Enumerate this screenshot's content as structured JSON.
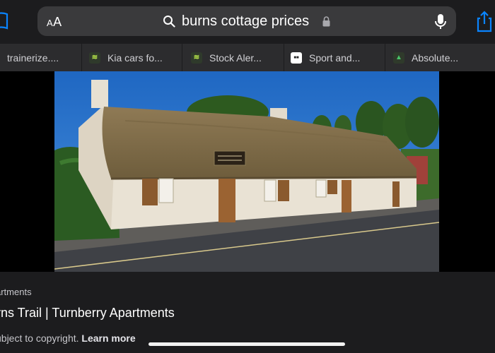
{
  "address_bar": {
    "reader_label": "AA",
    "query": "burns cottage prices"
  },
  "tabs": [
    {
      "label": "trainerize....",
      "icon": "none"
    },
    {
      "label": "Kia cars fo...",
      "icon": "kia-favicon"
    },
    {
      "label": "Stock Aler...",
      "icon": "stock-alert-favicon"
    },
    {
      "label": "Sport and...",
      "icon": "sport-favicon"
    },
    {
      "label": "Absolute...",
      "icon": "tree-favicon"
    }
  ],
  "image": {
    "subject": "thatched white cottage with sign",
    "sign_text": ""
  },
  "caption": {
    "source": "artments",
    "title": "rns Trail | Turnberry Apartments",
    "copyright": "ubject to copyright.",
    "learn_more": "Learn more"
  },
  "colors": {
    "background": "#1c1c1e",
    "url_bar": "#3a3a3c",
    "tab_bar": "#2c2c2e",
    "accent": "#0a84ff"
  }
}
